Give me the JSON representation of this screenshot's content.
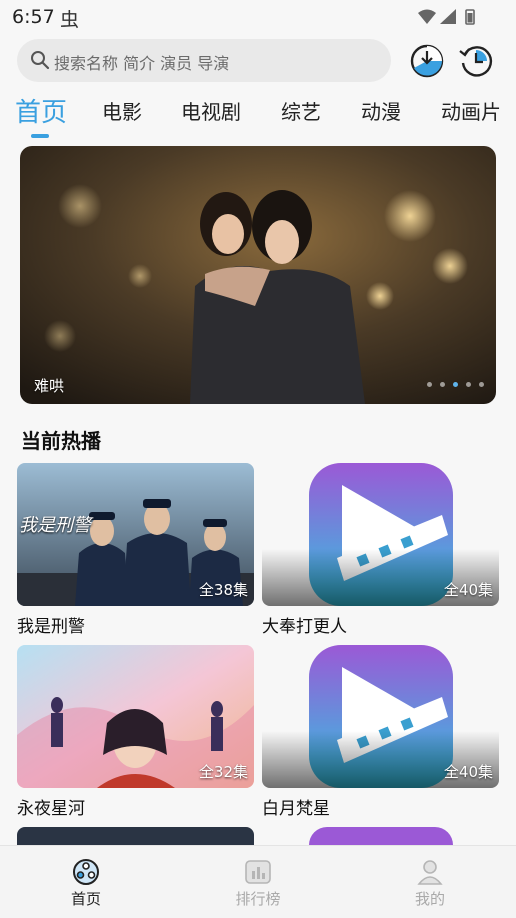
{
  "status_bar": {
    "time": "6:57",
    "notification_glyph": "虫"
  },
  "search": {
    "placeholder": "搜索名称 简介 演员 导演"
  },
  "tabs": [
    {
      "label": "首页",
      "active": true
    },
    {
      "label": "电影"
    },
    {
      "label": "电视剧"
    },
    {
      "label": "综艺"
    },
    {
      "label": "动漫"
    },
    {
      "label": "动画片"
    }
  ],
  "banner": {
    "caption": "难哄",
    "dot_count": 5,
    "active_dot": 2
  },
  "section": {
    "title": "当前热播"
  },
  "items": [
    {
      "title": "我是刑警",
      "episodes": "全38集",
      "poster_text": "我是刑警",
      "thumb": "police"
    },
    {
      "title": "大奉打更人",
      "episodes": "全40集",
      "thumb": "placeholder"
    },
    {
      "title": "永夜星河",
      "episodes": "全32集",
      "thumb": "fantasy"
    },
    {
      "title": "白月梵星",
      "episodes": "全40集",
      "thumb": "placeholder"
    }
  ],
  "bottom_nav": [
    {
      "label": "首页",
      "icon": "film-reel-icon",
      "active": true
    },
    {
      "label": "排行榜",
      "icon": "chart-icon"
    },
    {
      "label": "我的",
      "icon": "profile-icon"
    }
  ],
  "colors": {
    "accent": "#3aa0e0",
    "placeholder_grad_top": "#9b59d6",
    "placeholder_grad_bottom": "#32c3e0"
  }
}
